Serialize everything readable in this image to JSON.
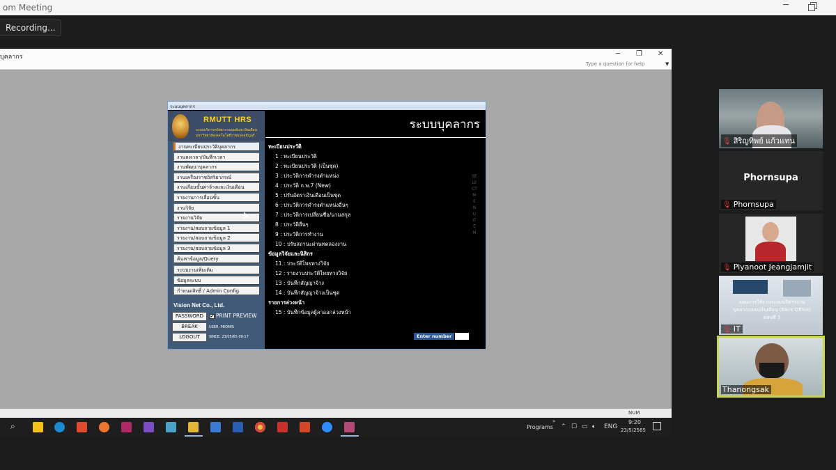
{
  "zoom": {
    "title": "om Meeting",
    "recording_label": "Recording..."
  },
  "access": {
    "title": "บุคลากร",
    "help_placeholder": "Type a question for help",
    "status_num": "NUM"
  },
  "hrs": {
    "window_title": "ระบบบุคลากร",
    "logo": {
      "name": "RMUTT HRS",
      "subtitle1": "ระบบบริหารทรัพยากรมนุษย์และเงินเดือน",
      "subtitle2": "มหาวิทยาลัยเทคโนโลยีราชมงคลธัญบุรี"
    },
    "menu": [
      "งานทะเบียนประวัติบุคลากร",
      "งานลงเวลา/บันทึกเวลา",
      "งานพัฒนาบุคลากร",
      "งานเครื่องราชอิสริยาภรณ์",
      "งานเลื่อนขั้นค่าจ้างและเงินเดือน",
      "รายงานการเลื่อนขั้น",
      "งานวิจัย",
      "รายงานวิจัย",
      "รายงาน/สอบถามข้อมูล 1",
      "รายงาน/สอบถามข้อมูล 2",
      "รายงาน/สอบถามข้อมูล 3",
      "ค้นหาข้อมูล/Query",
      "ระบบงานเพิ่มเติม",
      "ข้อมูลระบบ",
      "กำหนดสิทธิ์ / Admin Config"
    ],
    "company": "Vision Net Co., Ltd.",
    "password_label": "PASSWORD",
    "print_preview_label": "PRINT PREVIEW",
    "print_preview_checked": "✔",
    "break_label": "BREAK",
    "logout_label": "LOGOUT",
    "user_info": "USER: PROMIS",
    "since_info": "SINCE: 23/05/65 09:17",
    "heading": "ระบบบุคลากร",
    "sections": [
      {
        "title": "ทะเบียนประวัติ",
        "items": [
          "1 : ทะเบียนประวัติ",
          "2 : ทะเบียนประวัติ (เป็นชุด)",
          "3 : ประวัติการดำรงตำแหน่ง",
          "4 : ประวัติ ก.พ.7 (New)",
          "5 : ปรับอัตราเงินเดือนเป็นชุด",
          "6 : ประวัติการดำรงตำแหน่งอื่นๆ",
          "7 : ประวัติการเปลี่ยนชื่อ/นามสกุล",
          "8 : ประวัติอื่นๆ",
          "9 : ประวัติการทำงาน",
          "10 : ปรับสถานะผ่านทดลองงาน"
        ]
      },
      {
        "title": "ข้อมูลวิจัยและนิสิกร",
        "items": [
          "11 : ประวัติไทยทางวิจัย",
          "12 : รายงานประวัติไทยทางวิจัย",
          "13 : บันทึกสัญญาจ้าง",
          "14 : บันทึกสัญญาจ้างเป็นชุด"
        ]
      },
      {
        "title": "รายการล่วงหน้า",
        "items": [
          "15 : บันทึกข้อมูลผู้ลาออกล่วงหน้า"
        ]
      }
    ],
    "vertical_text": "SELECT MENU ITEM",
    "enter_number_label": "Enter number",
    "enter_number_value": ""
  },
  "taskbar": {
    "programs_label": "Programs",
    "chevron": "»",
    "lang": "ENG",
    "time": "9:20",
    "date": "23/5/2565",
    "apps": [
      "sticky-notes",
      "edge",
      "slides",
      "firefox",
      "media",
      "visual-studio",
      "office",
      "file-explorer",
      "people",
      "word",
      "chrome",
      "acrobat",
      "powerpoint",
      "zoom",
      "screenshot"
    ]
  },
  "participants": [
    {
      "name": "สิริญทิพย์ แก้วแทน",
      "muted": true
    },
    {
      "name": "Phornsupa",
      "display_name": "Phornsupa",
      "muted": true
    },
    {
      "name": "Piyanoot Jeangjamjit",
      "muted": true
    },
    {
      "name": "IT",
      "muted": true,
      "overlay_line1": "แผนการใช้งานระบบบริหารงาน",
      "overlay_line2": "บุคลากรและเงินเดือน (Back Office)",
      "overlay_line3": "ตอนที่ 1"
    },
    {
      "name": "Thanongsak",
      "muted": false,
      "active_speaker": true
    }
  ]
}
